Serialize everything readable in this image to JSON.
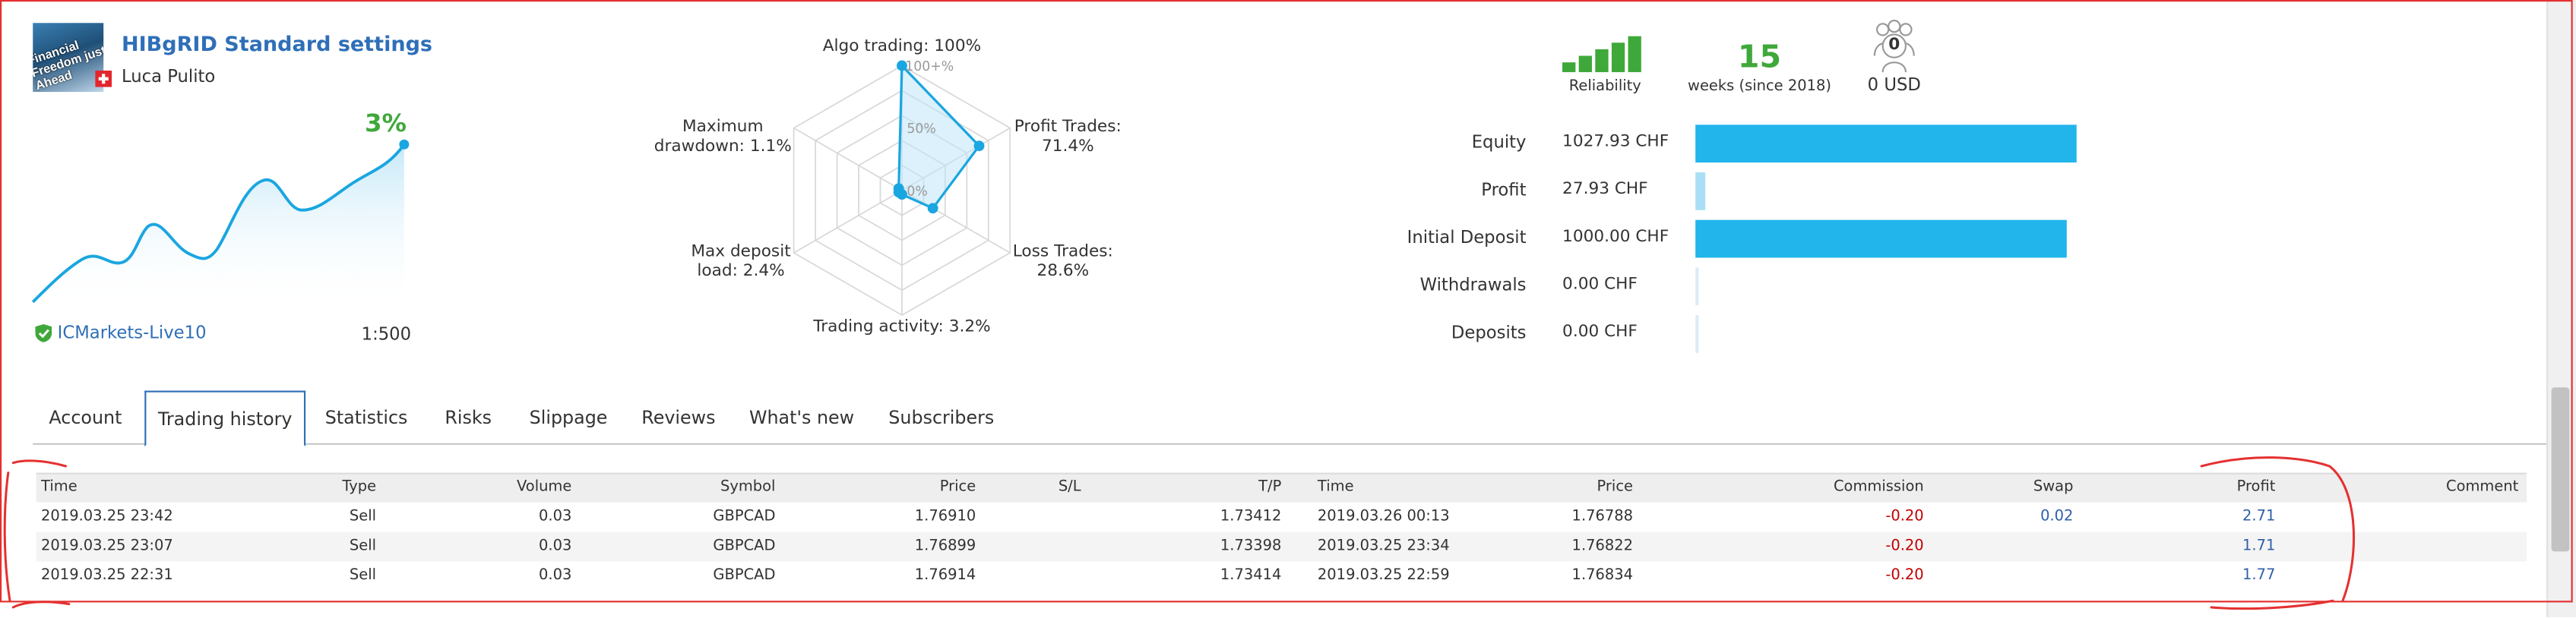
{
  "header": {
    "title": "HIBgRID Standard settings",
    "author": "Luca Pulito",
    "avatar_text": "Financial Freedom just Ahead",
    "growth": "3%",
    "broker": "ICMarkets-Live10",
    "leverage": "1:500"
  },
  "radar": {
    "algo": "Algo trading: 100%",
    "profit_trades_1": "Profit Trades:",
    "profit_trades_2": "71.4%",
    "loss_trades_1": "Loss Trades:",
    "loss_trades_2": "28.6%",
    "activity": "Trading activity: 3.2%",
    "deposit_load_1": "Max deposit",
    "deposit_load_2": "load: 2.4%",
    "drawdown_1": "Maximum",
    "drawdown_2": "drawdown: 1.1%",
    "tick_100": "100+%",
    "tick_50": "50%",
    "tick_0": "0%"
  },
  "stats": {
    "reliability_label": "Reliability",
    "weeks_number": "15",
    "weeks_label": "weeks (since 2018)",
    "subscribers_count": "0",
    "subscribers_value": "0 USD",
    "metrics": [
      {
        "label": "Equity",
        "value": "1027.93 CHF",
        "fill": 1.0,
        "color": "#21b5ec"
      },
      {
        "label": "Profit",
        "value": "27.93 CHF",
        "fill": 0.027,
        "color": "#a9dff4"
      },
      {
        "label": "Initial Deposit",
        "value": "1000.00 CHF",
        "fill": 0.973,
        "color": "#21b5ec"
      },
      {
        "label": "Withdrawals",
        "value": "0.00 CHF",
        "fill": 0,
        "color": "#21b5ec"
      },
      {
        "label": "Deposits",
        "value": "0.00 CHF",
        "fill": 0,
        "color": "#21b5ec"
      }
    ]
  },
  "tabs": [
    {
      "label": "Account",
      "active": false
    },
    {
      "label": "Trading history",
      "active": true
    },
    {
      "label": "Statistics",
      "active": false
    },
    {
      "label": "Risks",
      "active": false
    },
    {
      "label": "Slippage",
      "active": false
    },
    {
      "label": "Reviews",
      "active": false
    },
    {
      "label": "What's new",
      "active": false
    },
    {
      "label": "Subscribers",
      "active": false
    }
  ],
  "table": {
    "headers": [
      "Time",
      "Type",
      "Volume",
      "Symbol",
      "Price",
      "S/L",
      "T/P",
      "Time",
      "Price",
      "Commission",
      "Swap",
      "Profit",
      "Comment"
    ],
    "rows": [
      [
        "2019.03.25 23:42",
        "Sell",
        "0.03",
        "GBPCAD",
        "1.76910",
        "",
        "1.73412",
        "2019.03.26 00:13",
        "1.76788",
        "-0.20",
        "0.02",
        "2.71",
        ""
      ],
      [
        "2019.03.25 23:07",
        "Sell",
        "0.03",
        "GBPCAD",
        "1.76899",
        "",
        "1.73398",
        "2019.03.25 23:34",
        "1.76822",
        "-0.20",
        "",
        "1.71",
        ""
      ],
      [
        "2019.03.25 22:31",
        "Sell",
        "0.03",
        "GBPCAD",
        "1.76914",
        "",
        "1.73414",
        "2019.03.25 22:59",
        "1.76834",
        "-0.20",
        "",
        "1.77",
        ""
      ]
    ]
  },
  "colors": {
    "accent": "#2f6fb8",
    "positive": "#3fa83a",
    "negative": "#c00000",
    "bar": "#21b5ec",
    "annotation": "#e53030"
  }
}
